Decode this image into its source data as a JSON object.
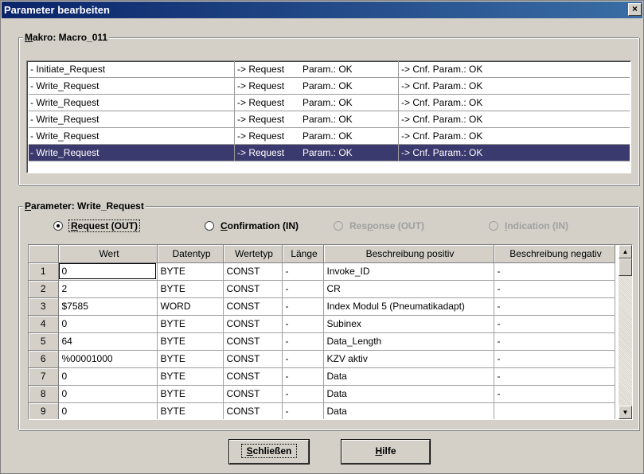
{
  "window": {
    "title": "Parameter bearbeiten",
    "close_glyph": "×"
  },
  "makro": {
    "legend_key": "M",
    "legend_rest": "akro: Macro_011",
    "rows": [
      {
        "name": "- Initiate_Request",
        "req": "-> Request",
        "param": "Param.: OK",
        "cnf": "-> Cnf. Param.: OK"
      },
      {
        "name": "- Write_Request",
        "req": "-> Request",
        "param": "Param.: OK",
        "cnf": "-> Cnf. Param.: OK"
      },
      {
        "name": "- Write_Request",
        "req": "-> Request",
        "param": "Param.: OK",
        "cnf": "-> Cnf. Param.: OK"
      },
      {
        "name": "- Write_Request",
        "req": "-> Request",
        "param": "Param.: OK",
        "cnf": "-> Cnf. Param.: OK"
      },
      {
        "name": "- Write_Request",
        "req": "-> Request",
        "param": "Param.: OK",
        "cnf": "-> Cnf. Param.: OK"
      },
      {
        "name": "- Write_Request",
        "req": "-> Request",
        "param": "Param.: OK",
        "cnf": "-> Cnf. Param.: OK"
      }
    ]
  },
  "parameter": {
    "legend_key": "P",
    "legend_rest": "arameter: Write_Request",
    "radios": [
      {
        "key": "R",
        "rest": "equest (OUT)",
        "selected": true,
        "disabled": false
      },
      {
        "key": "C",
        "rest": "onfirmation (IN)",
        "selected": false,
        "disabled": false
      },
      {
        "pre": "Res",
        "key": "p",
        "rest": "onse (OUT)",
        "selected": false,
        "disabled": true
      },
      {
        "key": "I",
        "rest": "ndication (IN)",
        "selected": false,
        "disabled": true
      }
    ],
    "columns": [
      "",
      "Wert",
      "Datentyp",
      "Wertetyp",
      "Länge",
      "Beschreibung positiv",
      "Beschreibung negativ"
    ],
    "rows": [
      [
        "1",
        "0",
        "BYTE",
        "CONST",
        "-",
        "Invoke_ID",
        "-"
      ],
      [
        "2",
        "2",
        "BYTE",
        "CONST",
        "-",
        "CR",
        "-"
      ],
      [
        "3",
        "$7585",
        "WORD",
        "CONST",
        "-",
        "Index Modul 5 (Pneumatikadapt)",
        "-"
      ],
      [
        "4",
        "0",
        "BYTE",
        "CONST",
        "-",
        "Subinex",
        "-"
      ],
      [
        "5",
        "64",
        "BYTE",
        "CONST",
        "-",
        "Data_Length",
        "-"
      ],
      [
        "6",
        "%00001000",
        "BYTE",
        "CONST",
        "-",
        "KZV aktiv",
        "-"
      ],
      [
        "7",
        "0",
        "BYTE",
        "CONST",
        "-",
        "Data",
        "-"
      ],
      [
        "8",
        "0",
        "BYTE",
        "CONST",
        "-",
        "Data",
        "-"
      ],
      [
        "9",
        "0",
        "BYTE",
        "CONST",
        "-",
        "Data",
        ""
      ]
    ]
  },
  "buttons": {
    "close_key": "S",
    "close_rest": "chließen",
    "help_key": "H",
    "help_rest": "ilfe"
  },
  "scroll_icons": {
    "up": "▲",
    "down": "▼"
  }
}
